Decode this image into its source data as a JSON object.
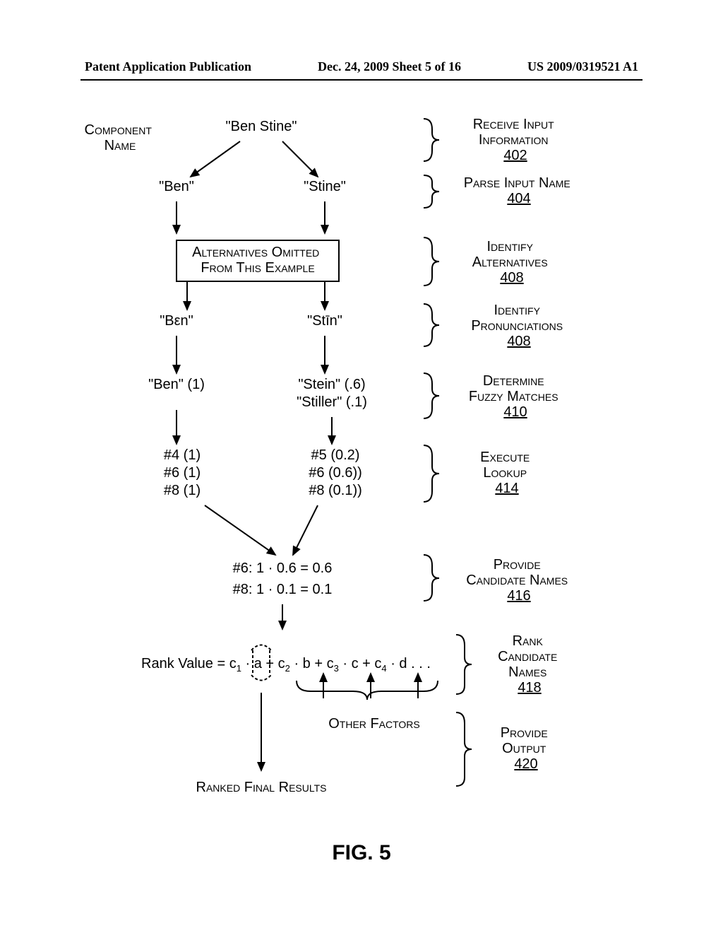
{
  "header": {
    "left": "Patent Application Publication",
    "center": "Dec. 24, 2009  Sheet 5 of 16",
    "right": "US 2009/0319521 A1"
  },
  "labels": {
    "component_name_1": "Component",
    "component_name_2": "Name",
    "input_name": "\"Ben Stine\"",
    "ben": "\"Ben\"",
    "stine": "\"Stine\"",
    "alt_omitted_1": "Alternatives Omitted",
    "alt_omitted_2": "From This Example",
    "ben_phon": "\"Bεn\"",
    "stin_phon": "\"Stīn\"",
    "ben1": "\"Ben\"  (1)",
    "stein": "\"Stein\"  (.6)",
    "stiller": "\"Stiller\"  (.1)",
    "l4": "#4 (1)",
    "l6": "#6 (1)",
    "l8": "#8 (1)",
    "r5": "#5 (0.2)",
    "r6": "#6 (0.6))",
    "r8": "#8 (0.1))",
    "cand6": "#6:   1 · 0.6 = 0.6",
    "cand8": "#8:   1 · 0.1 = 0.1",
    "rank_pre": "Rank Value = c",
    "rank_sub1": "1",
    "rank_mid1": " ·  a  + c",
    "rank_sub2": "2",
    "rank_mid2": " · b + c",
    "rank_sub3": "3",
    "rank_mid3": " · c + c",
    "rank_sub4": "4",
    "rank_mid4": " · d . . .",
    "other_factors": "Other Factors",
    "ranked_final": "Ranked Final Results"
  },
  "steps": {
    "s402_a": "Receive Input",
    "s402_b": "Information",
    "s402_n": "402",
    "s404_a": "Parse Input Name",
    "s404_n": "404",
    "s408a_a": "Identify",
    "s408a_b": "Alternatives",
    "s408a_n": "408",
    "s408b_a": "Identify",
    "s408b_b": "Pronunciations",
    "s408b_n": "408",
    "s410_a": "Determine",
    "s410_b": "Fuzzy Matches",
    "s410_n": "410",
    "s414_a": "Execute",
    "s414_b": "Lookup",
    "s414_n": "414",
    "s416_a": "Provide",
    "s416_b": "Candidate Names",
    "s416_n": "416",
    "s418_a": "Rank",
    "s418_b": "Candidate",
    "s418_c": "Names",
    "s418_n": "418",
    "s420_a": "Provide",
    "s420_b": "Output",
    "s420_n": "420"
  },
  "fig": "FIG. 5"
}
